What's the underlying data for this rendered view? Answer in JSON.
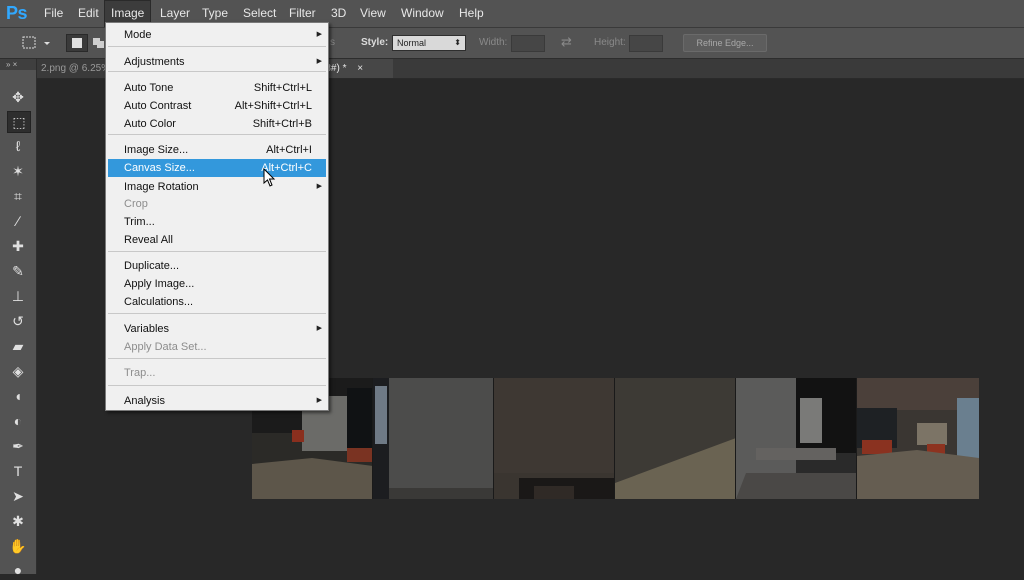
{
  "app": {
    "logo": "Ps",
    "menus": [
      "File",
      "Edit",
      "Image",
      "Layer",
      "Type",
      "Select",
      "Filter",
      "3D",
      "View",
      "Window",
      "Help"
    ],
    "active_menu": "Image"
  },
  "options_bar": {
    "hidden_fragment": "s",
    "style_label": "Style:",
    "style_value": "Normal",
    "width_label": "Width:",
    "height_label": "Height:",
    "refine_edge_label": "Refine Edge..."
  },
  "toolbox": {
    "header_glyphs": "»  ×",
    "tools": [
      {
        "name": "move-tool-icon",
        "glyph": "✥"
      },
      {
        "name": "rectangular-marquee-tool-icon",
        "glyph": "⬚"
      },
      {
        "name": "lasso-tool-icon",
        "glyph": "ℓ"
      },
      {
        "name": "magic-wand-tool-icon",
        "glyph": "✶"
      },
      {
        "name": "crop-tool-icon",
        "glyph": "⌗"
      },
      {
        "name": "eyedropper-tool-icon",
        "glyph": "∕"
      },
      {
        "name": "healing-brush-tool-icon",
        "glyph": "✚"
      },
      {
        "name": "brush-tool-icon",
        "glyph": "✎"
      },
      {
        "name": "clone-stamp-tool-icon",
        "glyph": "⊥"
      },
      {
        "name": "history-brush-tool-icon",
        "glyph": "↺"
      },
      {
        "name": "eraser-tool-icon",
        "glyph": "▰"
      },
      {
        "name": "paint-bucket-tool-icon",
        "glyph": "◈"
      },
      {
        "name": "blur-tool-icon",
        "glyph": "◖"
      },
      {
        "name": "dodge-tool-icon",
        "glyph": "◐"
      },
      {
        "name": "pen-tool-icon",
        "glyph": "✒"
      },
      {
        "name": "type-tool-icon",
        "glyph": "T"
      },
      {
        "name": "path-selection-tool-icon",
        "glyph": "➤"
      },
      {
        "name": "shape-tool-icon",
        "glyph": "✱"
      },
      {
        "name": "hand-tool-icon",
        "glyph": "✋"
      },
      {
        "name": "zoom-tool-icon",
        "glyph": "●"
      }
    ]
  },
  "document": {
    "tab_left": "2.png @ 6.25%",
    "tab_right": "3/8#) *",
    "tab_close": "×"
  },
  "image_menu": {
    "items": [
      {
        "label": "Mode",
        "shortcut": "",
        "submenu": true,
        "disabled": false,
        "highlight": false,
        "name": "menu-item-mode"
      },
      {
        "sep": true
      },
      {
        "label": "Adjustments",
        "shortcut": "",
        "submenu": true,
        "disabled": false,
        "highlight": false,
        "name": "menu-item-adjustments"
      },
      {
        "sep": true
      },
      {
        "label": "Auto Tone",
        "shortcut": "Shift+Ctrl+L",
        "submenu": false,
        "disabled": false,
        "highlight": false,
        "name": "menu-item-auto-tone"
      },
      {
        "label": "Auto Contrast",
        "shortcut": "Alt+Shift+Ctrl+L",
        "submenu": false,
        "disabled": false,
        "highlight": false,
        "name": "menu-item-auto-contrast"
      },
      {
        "label": "Auto Color",
        "shortcut": "Shift+Ctrl+B",
        "submenu": false,
        "disabled": false,
        "highlight": false,
        "name": "menu-item-auto-color"
      },
      {
        "sep": true
      },
      {
        "label": "Image Size...",
        "shortcut": "Alt+Ctrl+I",
        "submenu": false,
        "disabled": false,
        "highlight": false,
        "name": "menu-item-image-size"
      },
      {
        "label": "Canvas Size...",
        "shortcut": "Alt+Ctrl+C",
        "submenu": false,
        "disabled": false,
        "highlight": true,
        "name": "menu-item-canvas-size"
      },
      {
        "label": "Image Rotation",
        "shortcut": "",
        "submenu": true,
        "disabled": false,
        "highlight": false,
        "name": "menu-item-image-rotation"
      },
      {
        "label": "Crop",
        "shortcut": "",
        "submenu": false,
        "disabled": true,
        "highlight": false,
        "name": "menu-item-crop"
      },
      {
        "label": "Trim...",
        "shortcut": "",
        "submenu": false,
        "disabled": false,
        "highlight": false,
        "name": "menu-item-trim"
      },
      {
        "label": "Reveal All",
        "shortcut": "",
        "submenu": false,
        "disabled": false,
        "highlight": false,
        "name": "menu-item-reveal-all"
      },
      {
        "sep": true
      },
      {
        "label": "Duplicate...",
        "shortcut": "",
        "submenu": false,
        "disabled": false,
        "highlight": false,
        "name": "menu-item-duplicate"
      },
      {
        "label": "Apply Image...",
        "shortcut": "",
        "submenu": false,
        "disabled": false,
        "highlight": false,
        "name": "menu-item-apply-image"
      },
      {
        "label": "Calculations...",
        "shortcut": "",
        "submenu": false,
        "disabled": false,
        "highlight": false,
        "name": "menu-item-calculations"
      },
      {
        "sep": true
      },
      {
        "label": "Variables",
        "shortcut": "",
        "submenu": true,
        "disabled": false,
        "highlight": false,
        "name": "menu-item-variables"
      },
      {
        "label": "Apply Data Set...",
        "shortcut": "",
        "submenu": false,
        "disabled": true,
        "highlight": false,
        "name": "menu-item-apply-data-set"
      },
      {
        "sep": true
      },
      {
        "label": "Trap...",
        "shortcut": "",
        "submenu": false,
        "disabled": true,
        "highlight": false,
        "name": "menu-item-trap"
      },
      {
        "sep": true
      },
      {
        "label": "Analysis",
        "shortcut": "",
        "submenu": true,
        "disabled": false,
        "highlight": false,
        "name": "menu-item-analysis"
      }
    ]
  }
}
